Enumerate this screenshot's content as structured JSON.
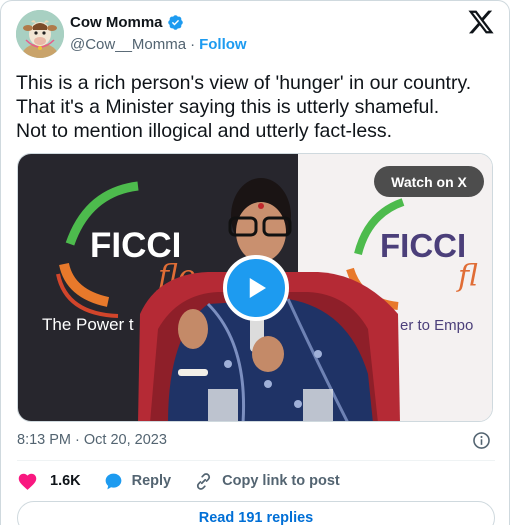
{
  "author": {
    "display_name": "Cow Momma",
    "handle": "@Cow__Momma",
    "separator": "·",
    "follow_label": "Follow"
  },
  "tweet": {
    "text_lines": [
      "This is a rich person's view of 'hunger' in our country.",
      "That it's a Minister saying this is utterly shameful.",
      "Not to mention illogical and utterly fact-less."
    ]
  },
  "media": {
    "watch_label": "Watch on X",
    "banner_left_title": "FICCI",
    "banner_left_script": "flo",
    "banner_left_tagline": "The Power t",
    "banner_right_title": "FICCI",
    "banner_right_script": "fl",
    "banner_right_tagline": "er to Empo"
  },
  "meta": {
    "timestamp": "8:13 PM · Oct 20, 2023"
  },
  "actions": {
    "like_count": "1.6K",
    "reply_label": "Reply",
    "copy_label": "Copy link to post"
  },
  "footer": {
    "read_replies_label": "Read 191 replies"
  },
  "colors": {
    "accent": "#1d9bf0",
    "like": "#f91880",
    "text": "#0f1419",
    "muted": "#536471"
  }
}
